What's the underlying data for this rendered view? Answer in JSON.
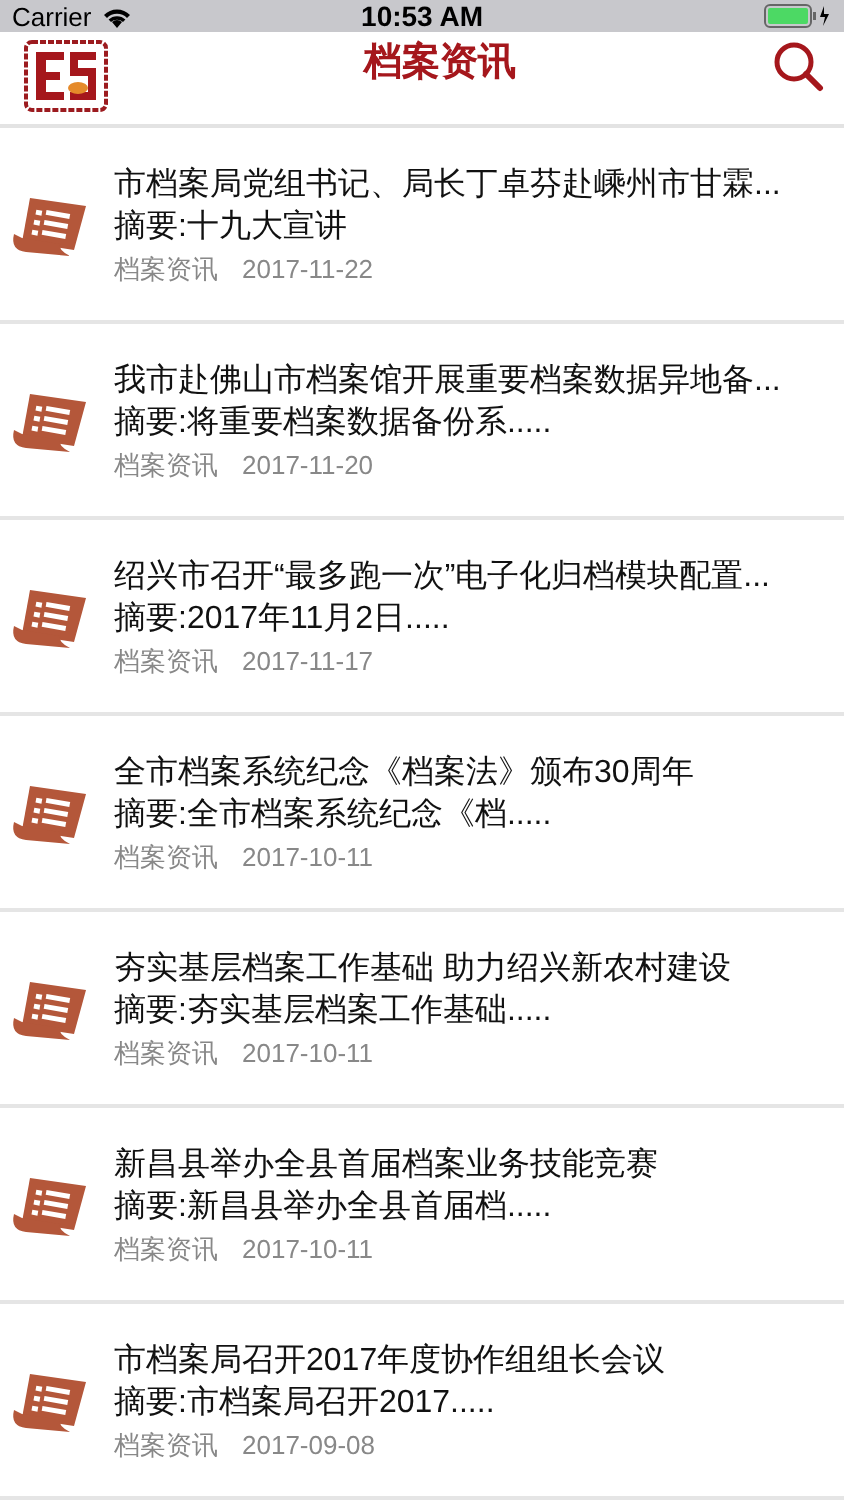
{
  "status_bar": {
    "carrier": "Carrier",
    "time": "10:53 AM"
  },
  "nav_bar": {
    "title": "档案资讯"
  },
  "articles": [
    {
      "title": "市档案局党组书记、局长丁卓芬赴嵊州市甘霖...",
      "summary": "摘要:十九大宣讲",
      "category": "档案资讯",
      "date": "2017-11-22"
    },
    {
      "title": "我市赴佛山市档案馆开展重要档案数据异地备...",
      "summary": "摘要:将重要档案数据备份系.....",
      "category": "档案资讯",
      "date": "2017-11-20"
    },
    {
      "title": "绍兴市召开“最多跑一次”电子化归档模块配置...",
      "summary": "摘要:2017年11月2日.....",
      "category": "档案资讯",
      "date": "2017-11-17"
    },
    {
      "title": "全市档案系统纪念《档案法》颁布30周年",
      "summary": "摘要:全市档案系统纪念《档.....",
      "category": "档案资讯",
      "date": "2017-10-11"
    },
    {
      "title": "夯实基层档案工作基础 助力绍兴新农村建设",
      "summary": "摘要:夯实基层档案工作基础.....",
      "category": "档案资讯",
      "date": "2017-10-11"
    },
    {
      "title": "新昌县举办全县首届档案业务技能竞赛",
      "summary": "摘要:新昌县举办全县首届档.....",
      "category": "档案资讯",
      "date": "2017-10-11"
    },
    {
      "title": "市档案局召开2017年度协作组组长会议",
      "summary": "摘要:市档案局召开2017.....",
      "category": "档案资讯",
      "date": "2017-09-08"
    }
  ]
}
